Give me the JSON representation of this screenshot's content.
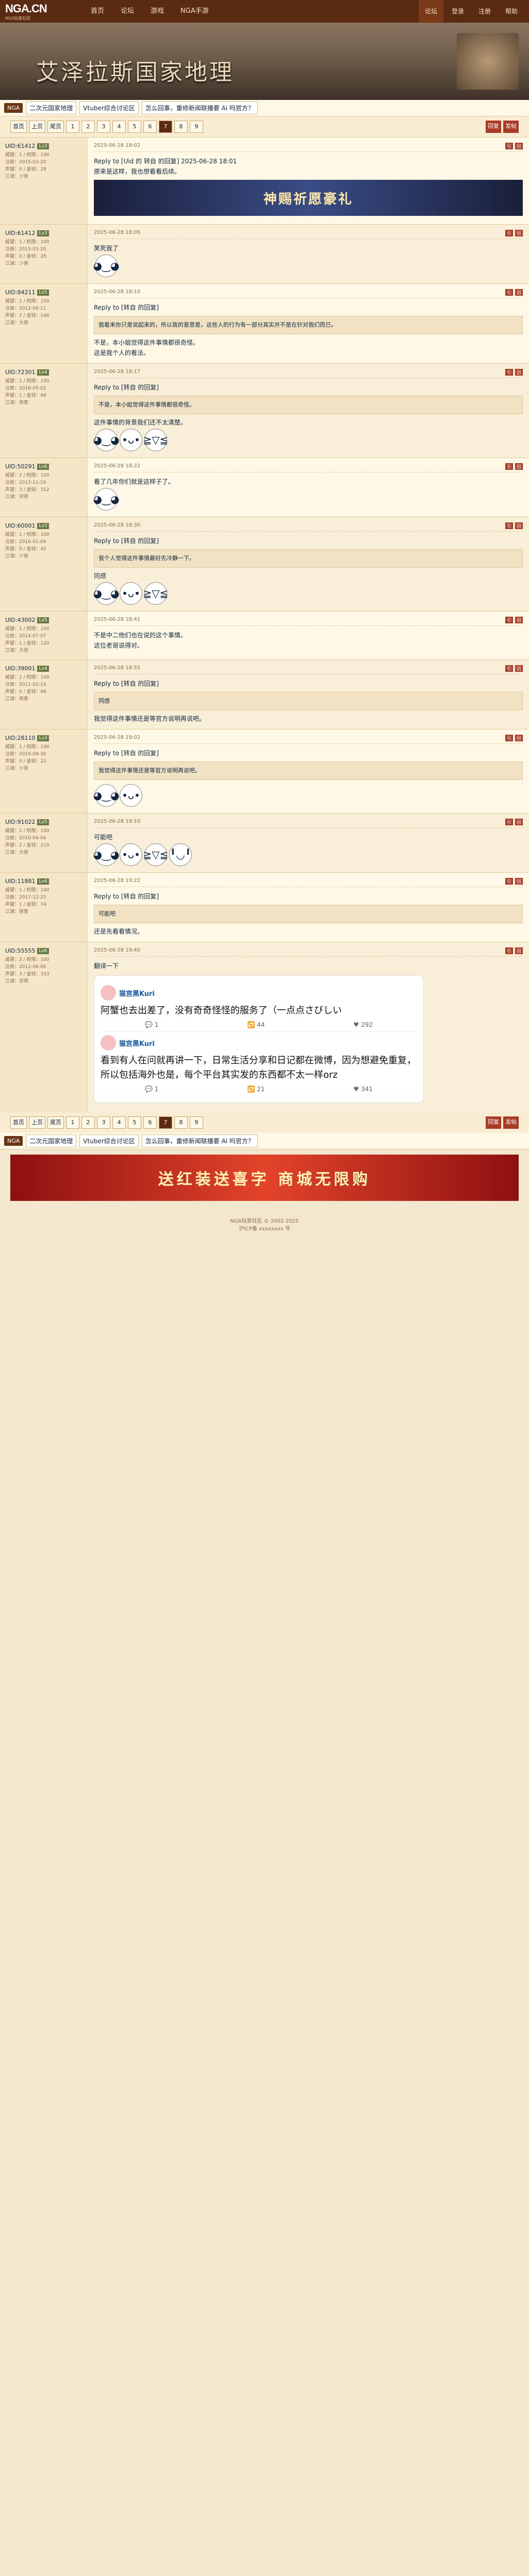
{
  "header": {
    "logo": "NGA.CN",
    "logo_sub": "NGA玩家社区",
    "nav": [
      "首页",
      "论坛",
      "游戏",
      "NGA手游"
    ],
    "right": [
      "登录",
      "注册",
      "帮助"
    ],
    "active_right": "论坛"
  },
  "banner": {
    "title": "艾泽拉斯国家地理"
  },
  "subnav": {
    "tag": "NGA",
    "items": [
      "二次元国家地理",
      "Vtuber综合讨论区",
      "怎么回事，重修新闻联播要 Ai 吗官方？"
    ]
  },
  "pager": {
    "pages": [
      "首页",
      "上页",
      "尾页",
      "1",
      "2",
      "3",
      "4",
      "5",
      "6",
      "7",
      "8",
      "9"
    ],
    "current": "7",
    "actions": [
      "回复",
      "发帖"
    ]
  },
  "posts": [
    {
      "user": "UID:61412",
      "level": "Lv3",
      "info": [
        "威望：1 / 权限：100",
        "注册：2015-03-20",
        "声望：0 / 金钱：28",
        "江湖：少侠"
      ],
      "time": "2025-06-28 18:02",
      "text": "Reply to [Uid 的 转自 的回复] 2025-06-28 18:01",
      "body": "原来是这样，我也想看看后续。",
      "emojis": 0,
      "ad": "神赐祈愿豪礼"
    },
    {
      "user": "UID:61412",
      "level": "Lv3",
      "info": [
        "威望：1 / 权限：100",
        "注册：2015-03-20",
        "声望：0 / 金钱：28",
        "江湖：少侠"
      ],
      "time": "2025-06-28 18:05",
      "text": "笑死我了",
      "body": "",
      "emojis": 1
    },
    {
      "user": "UID:84211",
      "level": "Lv5",
      "info": [
        "威望：1 / 权限：100",
        "注册：2012-08-11",
        "声望：2 / 金钱：146",
        "江湖：大侠"
      ],
      "time": "2025-06-28 18:10",
      "text": "Reply to [转自 的回复]",
      "quote": "我看来你只是说起来的，所以我的意思是，这些人的行为有一部分其实并不是在针对我们而已。",
      "body": "不是，本小姐觉得这件事情都很奇怪。\n这是我个人的看法。",
      "emojis": 0
    },
    {
      "user": "UID:72301",
      "level": "Lv4",
      "info": [
        "威望：1 / 权限：100",
        "注册：2018-05-02",
        "声望：1 / 金钱：88",
        "江湖：侠客"
      ],
      "time": "2025-06-28 18:17",
      "text": "Reply to [转自 的回复]",
      "quote": "不是，本小姐觉得这件事情都很奇怪。",
      "body": "这件事情的背景我们还不太清楚。",
      "emojis": 3
    },
    {
      "user": "UID:50291",
      "level": "Lv6",
      "info": [
        "威望：2 / 权限：100",
        "注册：2013-11-19",
        "声望：3 / 金钱：312",
        "江湖：宗师"
      ],
      "time": "2025-06-28 18:22",
      "text": "看了几年你们就是这样子了。",
      "body": "",
      "emojis": 1
    },
    {
      "user": "UID:60001",
      "level": "Lv3",
      "info": [
        "威望：1 / 权限：100",
        "注册：2016-01-09",
        "声望：0 / 金钱：42",
        "江湖：少侠"
      ],
      "time": "2025-06-28 18:30",
      "text": "Reply to [转自 的回复]",
      "quote": "我个人觉得这件事情最好先冷静一下。",
      "body": "同感",
      "emojis": 3
    },
    {
      "user": "UID:43002",
      "level": "Lv5",
      "info": [
        "威望：1 / 权限：100",
        "注册：2014-07-07",
        "声望：1 / 金钱：120",
        "江湖：大侠"
      ],
      "time": "2025-06-28 18:41",
      "text": "不是中二他们也在说的这个事情。",
      "body": "这位老哥说得对。",
      "emojis": 0
    },
    {
      "user": "UID:39001",
      "level": "Lv4",
      "info": [
        "威望：1 / 权限：100",
        "注册：2011-02-14",
        "声望：0 / 金钱：66",
        "江湖：侠客"
      ],
      "time": "2025-06-28 18:55",
      "text": "Reply to [转自 的回复]",
      "quote": "同感",
      "body": "我觉得这件事情还是等官方说明再说吧。",
      "emojis": 0
    },
    {
      "user": "UID:28110",
      "level": "Lv3",
      "info": [
        "威望：1 / 权限：100",
        "注册：2019-09-30",
        "声望：0 / 金钱：22",
        "江湖：少侠"
      ],
      "time": "2025-06-28 19:02",
      "text": "Reply to [转自 的回复]",
      "quote": "我觉得这件事情还是等官方说明再说吧。",
      "body": "",
      "emojis": 2
    },
    {
      "user": "UID:91022",
      "level": "Lv5",
      "info": [
        "威望：2 / 权限：100",
        "注册：2010-04-04",
        "声望：2 / 金钱：210",
        "江湖：大侠"
      ],
      "time": "2025-06-28 19:10",
      "text": "可能吧",
      "body": "",
      "emojis": 4
    },
    {
      "user": "UID:11881",
      "level": "Lv4",
      "info": [
        "威望：1 / 权限：100",
        "注册：2017-12-25",
        "声望：1 / 金钱：74",
        "江湖：侠客"
      ],
      "time": "2025-06-28 19:22",
      "text": "Reply to [转自 的回复]",
      "quote": "可能吧",
      "body": "还是先看看情况。",
      "emojis": 0
    },
    {
      "user": "UID:55555",
      "level": "Lv6",
      "info": [
        "威望：2 / 权限：100",
        "注册：2012-06-06",
        "声望：3 / 金钱：333",
        "江湖：宗师"
      ],
      "time": "2025-06-28 19:40",
      "text": "翻译一下",
      "body": "",
      "emojis": 0,
      "tweets": [
        {
          "user": "猫宫黑Kuri",
          "body": "阿蟹也去出差了，没有奇奇怪怪的服务了（一点点さびしい",
          "replies": "1",
          "retweets": "44",
          "likes": "292"
        },
        {
          "user": "猫宫黑Kuri",
          "body": "看到有人在问就再讲一下，日常生活分享和日记都在微博，因为想避免重复，所以包括海外也是，每个平台其实发的东西都不太一样orz",
          "replies": "1",
          "retweets": "21",
          "likes": "341"
        }
      ]
    }
  ],
  "footer": {
    "line1": "NGA玩家社区 © 2002-2025",
    "line2": "沪ICP备 xxxxxxxx 号"
  },
  "bottom_ad": "送红装送喜字 商城无限购"
}
